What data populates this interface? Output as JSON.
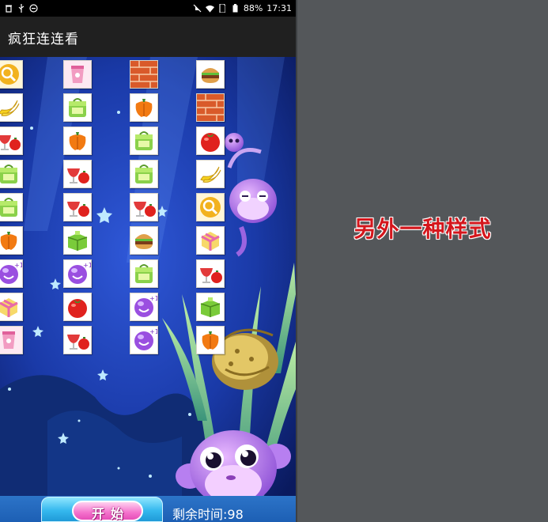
{
  "status_bar": {
    "battery": "88%",
    "time": "17:31",
    "left_icons": [
      "trash-icon",
      "usb-icon",
      "settings-icon"
    ],
    "right_icons": [
      "mute-icon",
      "wifi-icon",
      "sim-icon",
      "battery-icon"
    ]
  },
  "app": {
    "title": "疯狂连连看"
  },
  "board": {
    "columns": 4,
    "rows": 9,
    "grid": [
      [
        "search",
        "cup",
        "brick",
        "burger"
      ],
      [
        "banana",
        "bag",
        "pepper",
        "brick"
      ],
      [
        "juice",
        "pepper",
        "bag",
        "tomato"
      ],
      [
        "bag",
        "juice",
        "bag",
        "banana"
      ],
      [
        "bag",
        "juice",
        "juice",
        "search"
      ],
      [
        "pepper",
        "box",
        "burger",
        "gift"
      ],
      [
        "ball",
        "ball",
        "bag",
        "juice"
      ],
      [
        "gift",
        "tomato",
        "ball",
        "box"
      ],
      [
        "cup",
        "juice",
        "ball",
        "pepper"
      ]
    ]
  },
  "controls": {
    "start_label": "开始",
    "time_label": "剩余时间:98",
    "time_remaining": 98
  },
  "caption": "另外一种样式",
  "colors": {
    "page_background": "#54575a",
    "caption": "#d4161c",
    "app_bar": "#202020",
    "bottom_bar": "#1d5fb4"
  }
}
